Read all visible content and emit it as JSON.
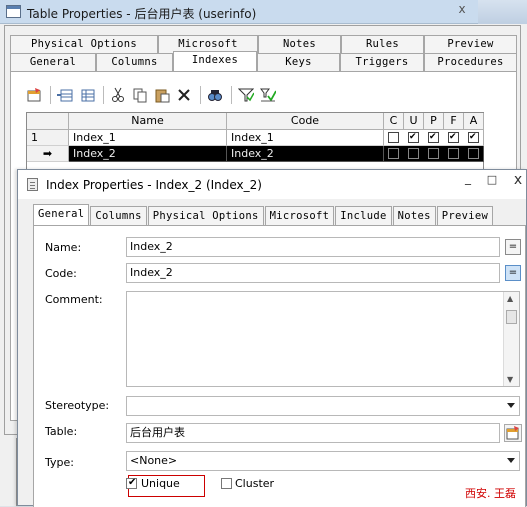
{
  "outer": {
    "title": "Table Properties - 后台用户表 (userinfo)",
    "close_glyph": "x",
    "tabs_row1": [
      "Physical Options",
      "Microsoft",
      "Notes",
      "Rules",
      "Preview"
    ],
    "tabs_row2": [
      "General",
      "Columns",
      "Indexes",
      "Keys",
      "Triggers",
      "Procedures"
    ],
    "selected_tab": "Indexes",
    "toolbar_icons": [
      "properties-icon",
      "add-row-icon",
      "insert-row-icon",
      "cut-icon",
      "copy-icon",
      "paste-icon",
      "delete-icon",
      "find-icon",
      "filter-icon",
      "customize-columns-icon"
    ],
    "grid": {
      "headers": [
        "Name",
        "Code",
        "C",
        "U",
        "P",
        "F",
        "A"
      ],
      "rows": [
        {
          "marker": "1",
          "name": "Index_1",
          "code": "Index_1",
          "flags": [
            false,
            true,
            true,
            true,
            true
          ],
          "selected": false
        },
        {
          "marker": "➡",
          "name": "Index_2",
          "code": "Index_2",
          "flags": [
            false,
            false,
            false,
            false,
            false
          ],
          "selected": true
        }
      ]
    }
  },
  "inner": {
    "title": "Index Properties - Index_2 (Index_2)",
    "min_glyph": "_",
    "max_glyph": "□",
    "close_glyph": "x",
    "tabs": [
      "General",
      "Columns",
      "Physical Options",
      "Microsoft",
      "Include",
      "Notes",
      "Preview"
    ],
    "selected_tab": "General",
    "form": {
      "name_label": "Name:",
      "name_value": "Index_2",
      "code_label": "Code:",
      "code_value": "Index_2",
      "eq_glyph": "=",
      "comment_label": "Comment:",
      "comment_value": "",
      "stereotype_label": "Stereotype:",
      "stereotype_value": "",
      "table_label": "Table:",
      "table_value": "后台用户表",
      "type_label": "Type:",
      "type_value": "<None>",
      "unique_label": "Unique",
      "unique_checked": true,
      "cluster_label": "Cluster",
      "cluster_checked": false
    }
  },
  "watermark": "西安. 王磊",
  "colors": {
    "accent": "#cc0000",
    "title_bar": "#c9dbee"
  }
}
